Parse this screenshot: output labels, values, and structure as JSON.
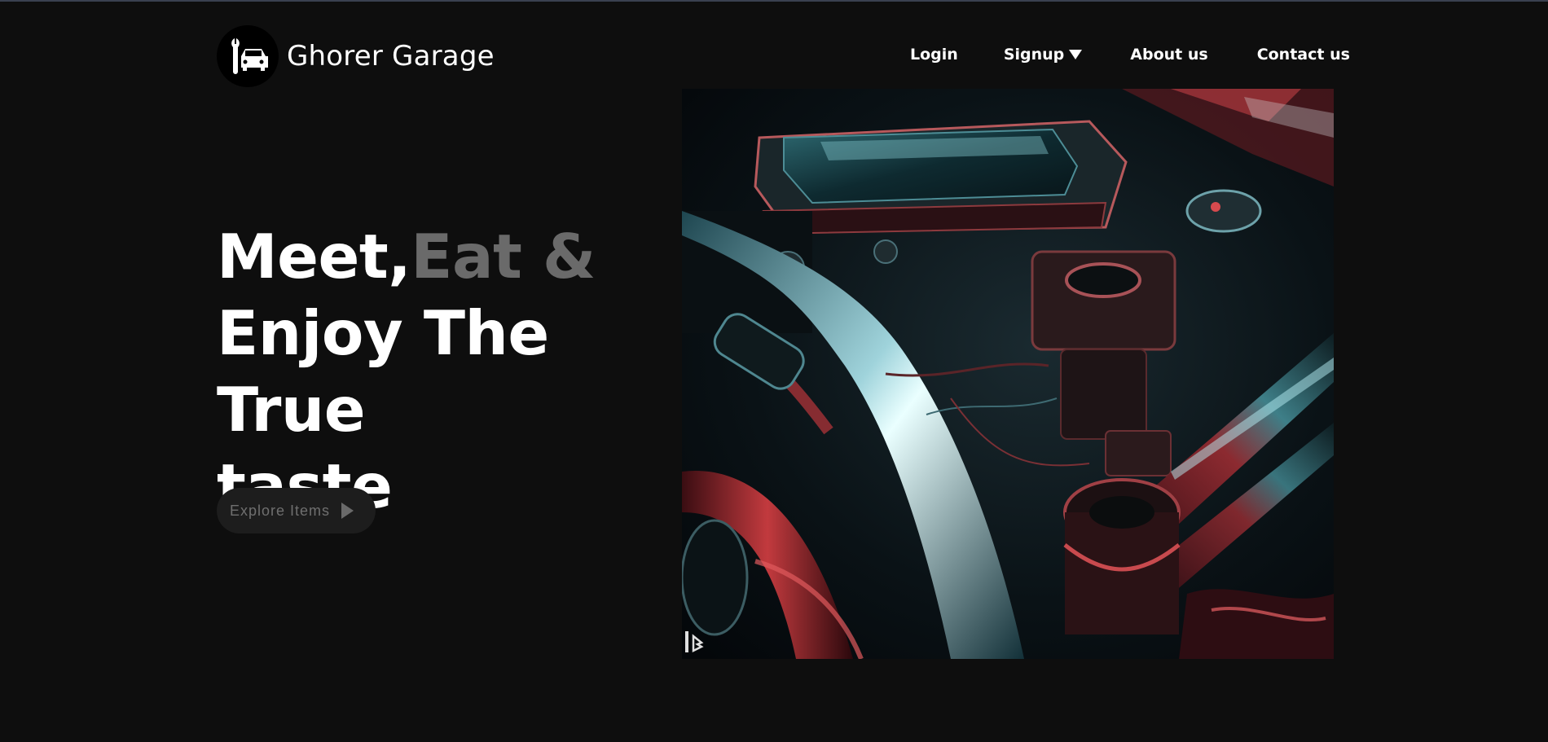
{
  "brand": {
    "name": "Ghorer Garage",
    "logo_icon": "wrench-car-icon"
  },
  "nav": {
    "items": [
      {
        "label": "Login"
      },
      {
        "label": "Signup",
        "icon": "caret-down-icon"
      },
      {
        "label": "About us"
      },
      {
        "label": "Contact us"
      }
    ]
  },
  "hero": {
    "line1_a": "Meet,",
    "line1_b": "Eat &",
    "line2": "Enjoy The True",
    "line3": "taste",
    "cta_label": "Explore Items",
    "cta_icon": "play-icon"
  },
  "image": {
    "alt": "car engine",
    "watermark_icon": "bing-logo-icon"
  },
  "colors": {
    "background": "#0e0e0e",
    "text": "#ffffff",
    "muted": "#6a6a6a",
    "button_bg": "#1d1d1d"
  }
}
